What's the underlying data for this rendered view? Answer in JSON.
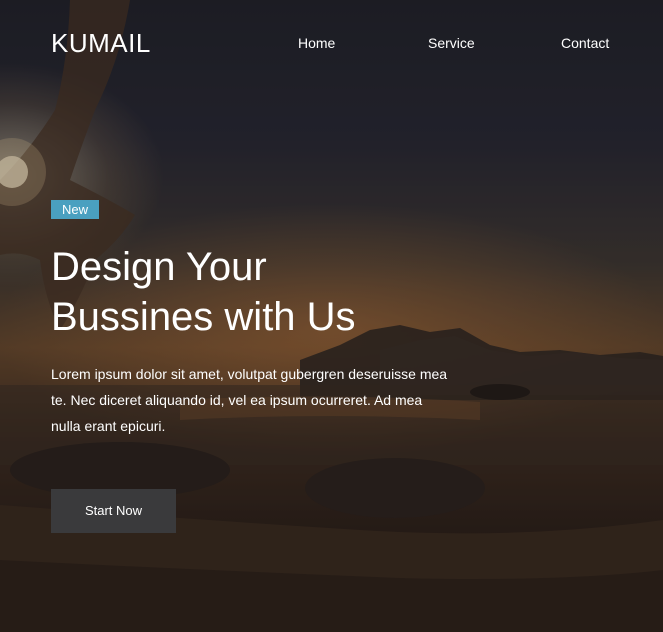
{
  "navbar": {
    "logo": "KUMAIL",
    "links": [
      "Home",
      "Service",
      "Contact"
    ]
  },
  "hero": {
    "badge": "New",
    "headline_line1": "Design Your",
    "headline_line2": "Bussines with Us",
    "body": "Lorem ipsum dolor sit amet, volutpat gubergren deseruisse mea te. Nec diceret aliquando id, vel ea ipsum ocurreret. Ad mea nulla erant epicuri.",
    "cta_label": "Start Now"
  },
  "colors": {
    "badge_bg": "#4aa0c0",
    "cta_bg": "#3a3a3c",
    "text": "#ffffff"
  }
}
